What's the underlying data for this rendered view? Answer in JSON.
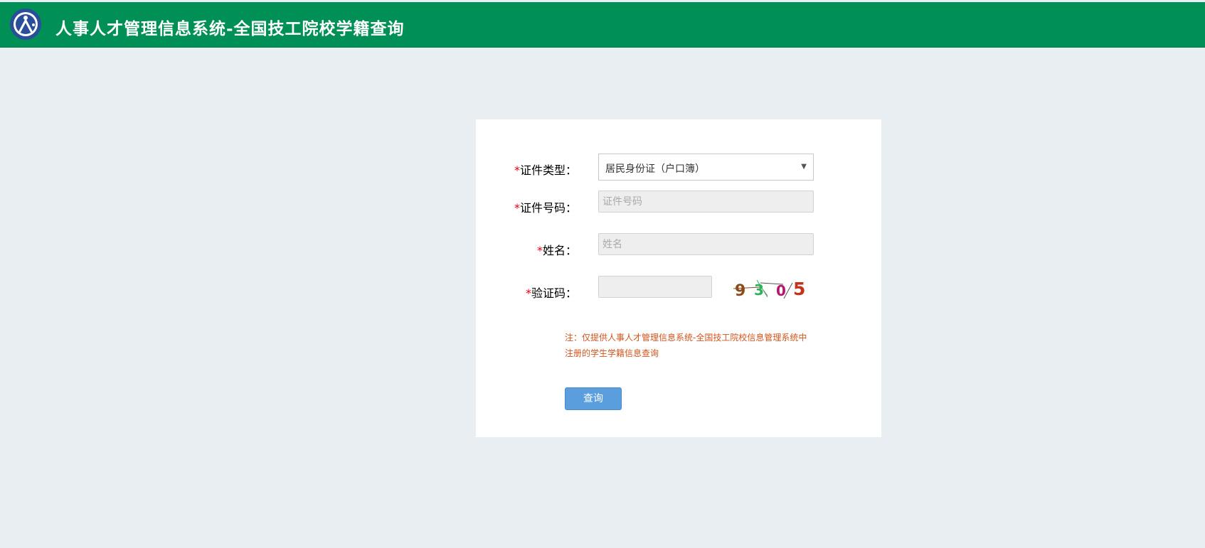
{
  "header": {
    "title": "人事人才管理信息系统-全国技工院校学籍查询"
  },
  "form": {
    "required_mark": "*",
    "id_type": {
      "label": "证件类型：",
      "selected": "居民身份证（户口簿）"
    },
    "id_number": {
      "label": "证件号码：",
      "placeholder": "证件号码"
    },
    "name": {
      "label": "姓名：",
      "placeholder": "姓名"
    },
    "captcha": {
      "label": "验证码：",
      "image_text": [
        "9",
        "3",
        "0",
        "5"
      ],
      "digit_colors": [
        "#8b4a1a",
        "#2fae5c",
        "#b5176b",
        "#c4321c"
      ]
    },
    "note": "注：仅提供人事人才管理信息系统-全国技工院校信息管理系统中注册的学生学籍信息查询",
    "submit_label": "查询"
  },
  "colors": {
    "header_bg": "#009055",
    "page_bg": "#e8eef2",
    "button_bg": "#5b9ede",
    "note_text": "#d2541e",
    "required": "#e60012"
  },
  "icons": {
    "logo": "person-circle-logo-icon",
    "dropdown": "triangle-down-icon"
  }
}
